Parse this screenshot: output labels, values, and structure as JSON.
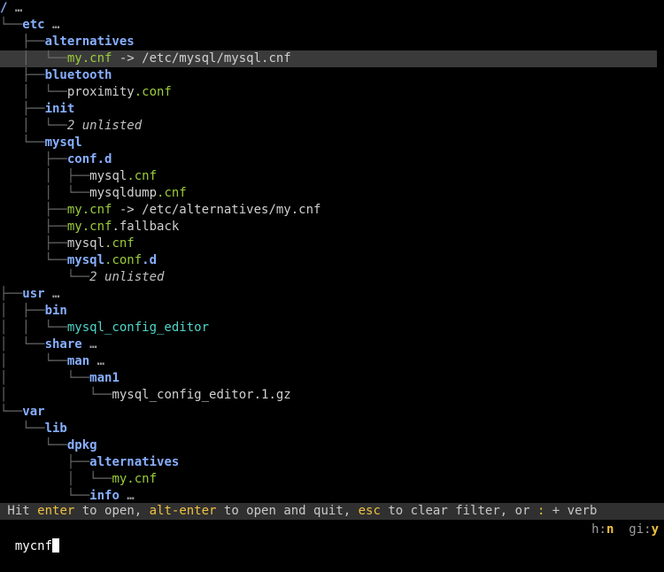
{
  "tree": {
    "rows": [
      {
        "depth": 0,
        "guide": "",
        "parts": [
          {
            "t": "/",
            "c": "root"
          },
          {
            "t": " …",
            "c": "ell"
          }
        ],
        "selected": false
      },
      {
        "depth": 1,
        "guide": "└──",
        "parts": [
          {
            "t": "etc",
            "c": "dir"
          },
          {
            "t": " …",
            "c": "ell"
          }
        ]
      },
      {
        "depth": 2,
        "guide": "├──",
        "parts": [
          {
            "t": "alternatives",
            "c": "dir"
          }
        ]
      },
      {
        "depth": 3,
        "guide": "└──",
        "parts": [
          {
            "t": "my.cnf",
            "c": "match"
          },
          {
            "t": " -> /etc/mysql/mysql.cnf",
            "c": "file"
          }
        ],
        "selected": true
      },
      {
        "depth": 2,
        "guide": "├──",
        "parts": [
          {
            "t": "bluetooth",
            "c": "dir"
          }
        ]
      },
      {
        "depth": 3,
        "guide": "└──",
        "parts": [
          {
            "t": "proximity",
            "c": "file"
          },
          {
            "t": ".conf",
            "c": "match"
          }
        ]
      },
      {
        "depth": 2,
        "guide": "├──",
        "parts": [
          {
            "t": "init",
            "c": "dir"
          }
        ]
      },
      {
        "depth": 3,
        "guide": "└──",
        "parts": [
          {
            "t": "2 unlisted",
            "c": "unlisted"
          }
        ]
      },
      {
        "depth": 2,
        "guide": "└──",
        "parts": [
          {
            "t": "mysql",
            "c": "dir"
          }
        ]
      },
      {
        "depth": 3,
        "guide": "├──",
        "parts": [
          {
            "t": "conf.d",
            "c": "dir"
          }
        ]
      },
      {
        "depth": 4,
        "guide": "├──",
        "parts": [
          {
            "t": "mysql",
            "c": "file"
          },
          {
            "t": ".cnf",
            "c": "match"
          }
        ]
      },
      {
        "depth": 4,
        "guide": "└──",
        "parts": [
          {
            "t": "mysqldump",
            "c": "file"
          },
          {
            "t": ".cnf",
            "c": "match"
          }
        ]
      },
      {
        "depth": 3,
        "guide": "├──",
        "parts": [
          {
            "t": "my.cnf",
            "c": "match"
          },
          {
            "t": " -> /etc/alternatives/my.cnf",
            "c": "file"
          }
        ]
      },
      {
        "depth": 3,
        "guide": "├──",
        "parts": [
          {
            "t": "my.cnf",
            "c": "match"
          },
          {
            "t": ".fallback",
            "c": "file"
          }
        ]
      },
      {
        "depth": 3,
        "guide": "├──",
        "parts": [
          {
            "t": "mysql",
            "c": "file"
          },
          {
            "t": ".cnf",
            "c": "match"
          }
        ]
      },
      {
        "depth": 3,
        "guide": "└──",
        "parts": [
          {
            "t": "mysql",
            "c": "dir"
          },
          {
            "t": ".conf",
            "c": "match"
          },
          {
            "t": ".d",
            "c": "dir"
          }
        ]
      },
      {
        "depth": 4,
        "guide": "└──",
        "parts": [
          {
            "t": "2 unlisted",
            "c": "unlisted"
          }
        ]
      },
      {
        "depth": 1,
        "guide": "├──",
        "parts": [
          {
            "t": "usr",
            "c": "dir"
          },
          {
            "t": " …",
            "c": "ell"
          }
        ]
      },
      {
        "depth": 2,
        "guide": "├──",
        "parts": [
          {
            "t": "bin",
            "c": "dir"
          }
        ]
      },
      {
        "depth": 3,
        "guide": "└──",
        "parts": [
          {
            "t": "mysql_config_editor",
            "c": "exec"
          }
        ]
      },
      {
        "depth": 2,
        "guide": "└──",
        "parts": [
          {
            "t": "share",
            "c": "dir"
          },
          {
            "t": " …",
            "c": "ell"
          }
        ]
      },
      {
        "depth": 3,
        "guide": "└──",
        "parts": [
          {
            "t": "man",
            "c": "dir"
          },
          {
            "t": " …",
            "c": "ell"
          }
        ]
      },
      {
        "depth": 4,
        "guide": "└──",
        "parts": [
          {
            "t": "man1",
            "c": "dir"
          }
        ]
      },
      {
        "depth": 5,
        "guide": "└──",
        "parts": [
          {
            "t": "mysql_config_editor.1.gz",
            "c": "file"
          }
        ]
      },
      {
        "depth": 1,
        "guide": "└──",
        "parts": [
          {
            "t": "var",
            "c": "dir"
          }
        ]
      },
      {
        "depth": 2,
        "guide": "└──",
        "parts": [
          {
            "t": "lib",
            "c": "dir"
          }
        ]
      },
      {
        "depth": 3,
        "guide": "└──",
        "parts": [
          {
            "t": "dpkg",
            "c": "dir"
          }
        ]
      },
      {
        "depth": 4,
        "guide": "├──",
        "parts": [
          {
            "t": "alternatives",
            "c": "dir"
          }
        ]
      },
      {
        "depth": 5,
        "guide": "└──",
        "parts": [
          {
            "t": "my.cnf",
            "c": "match"
          }
        ]
      },
      {
        "depth": 4,
        "guide": "└──",
        "parts": [
          {
            "t": "info",
            "c": "dir"
          },
          {
            "t": " …",
            "c": "ell"
          }
        ]
      }
    ]
  },
  "status_bar": {
    "segments": [
      {
        "t": " Hit ",
        "hl": false
      },
      {
        "t": "enter",
        "hl": true
      },
      {
        "t": " to open, ",
        "hl": false
      },
      {
        "t": "alt-enter",
        "hl": true
      },
      {
        "t": " to open and quit, ",
        "hl": false
      },
      {
        "t": "esc",
        "hl": true
      },
      {
        "t": " to clear filter, or ",
        "hl": false
      },
      {
        "t": ":",
        "hl": true
      },
      {
        "t": " + verb",
        "hl": false
      }
    ]
  },
  "input": {
    "value": "mycnf",
    "flags": [
      {
        "key": "h:",
        "val": "n"
      },
      {
        "key": "gi:",
        "val": "y"
      }
    ]
  },
  "colors": {
    "background": "#000000",
    "directory": "#87afff",
    "match": "#9ccc3a",
    "executable": "#4fd6c8",
    "highlight": "#f0c040",
    "selection": "#3a3a3a"
  }
}
